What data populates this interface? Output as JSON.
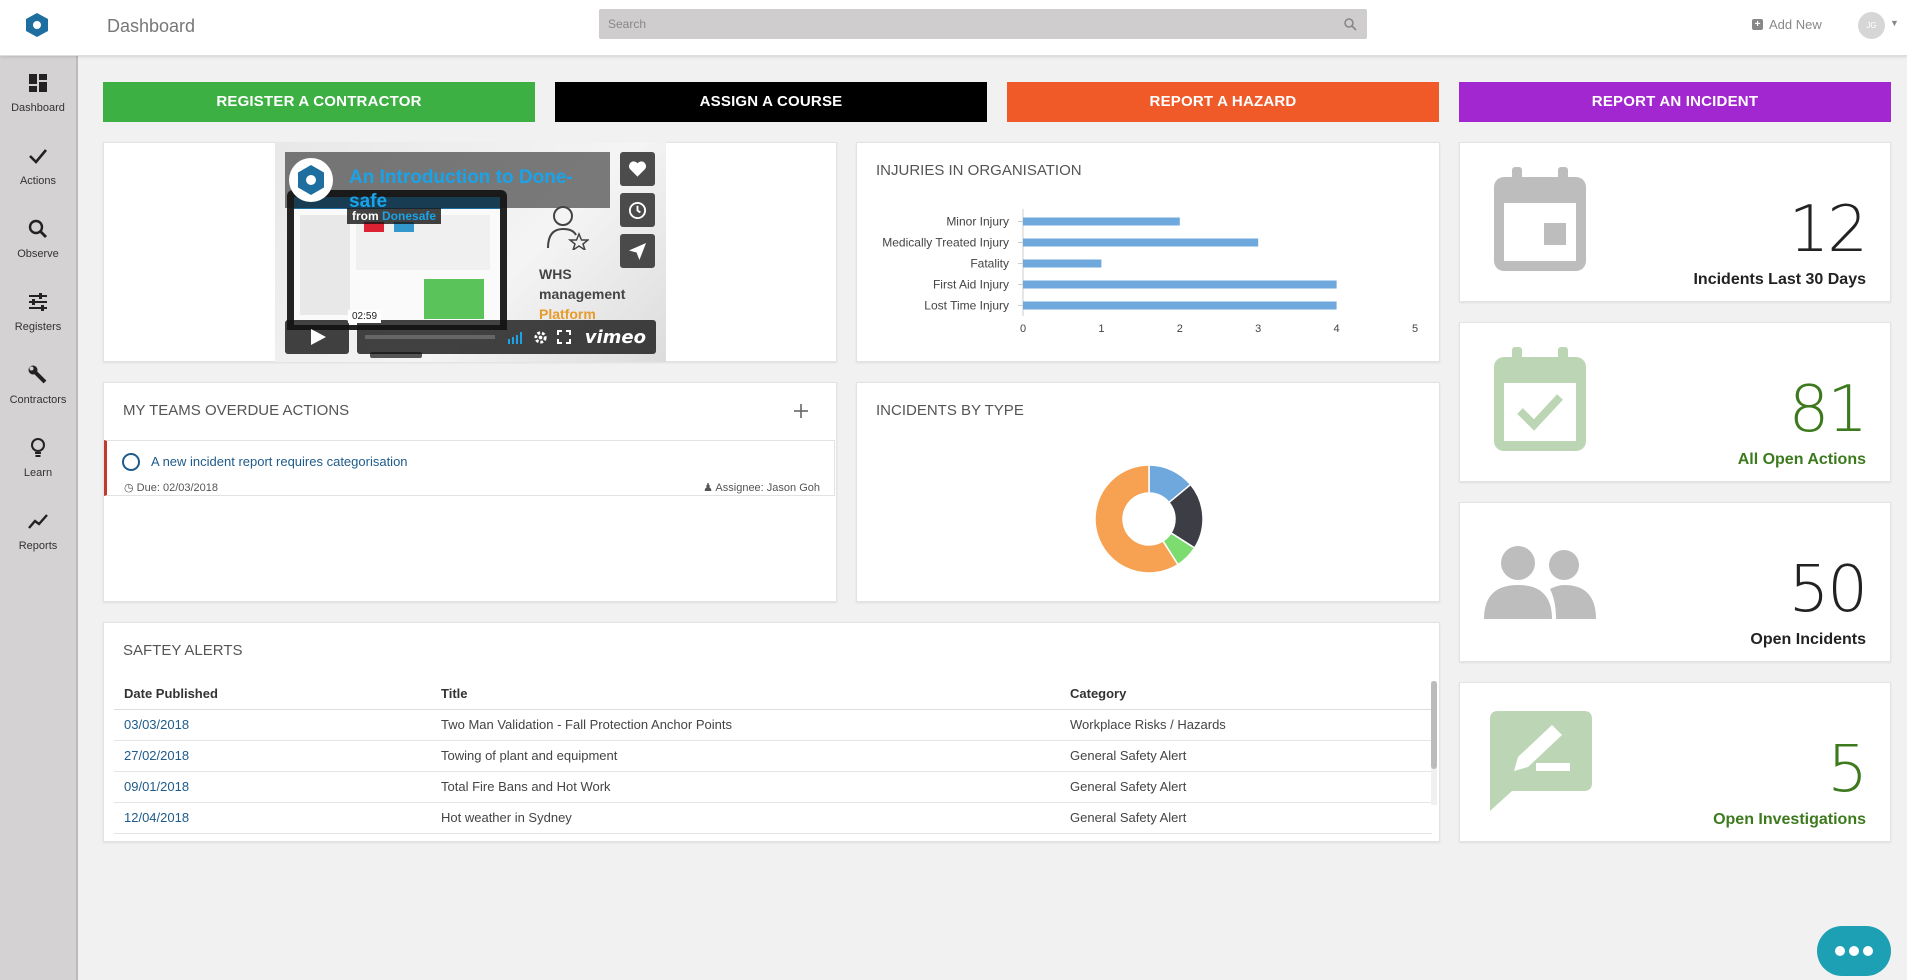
{
  "header": {
    "title": "Dashboard",
    "search_placeholder": "Search",
    "add_new_label": "Add New",
    "avatar_initials": "JG"
  },
  "sidebar": {
    "items": [
      {
        "label": "Dashboard",
        "icon": "dashboard-icon"
      },
      {
        "label": "Actions",
        "icon": "check-icon"
      },
      {
        "label": "Observe",
        "icon": "search-icon"
      },
      {
        "label": "Registers",
        "icon": "sliders-icon"
      },
      {
        "label": "Contractors",
        "icon": "wrench-icon"
      },
      {
        "label": "Learn",
        "icon": "lightbulb-icon"
      },
      {
        "label": "Reports",
        "icon": "trend-icon"
      }
    ]
  },
  "actions": [
    {
      "label": "REGISTER A CONTRACTOR",
      "color": "#3cb043"
    },
    {
      "label": "ASSIGN A COURSE",
      "color": "#000000"
    },
    {
      "label": "REPORT A HAZARD",
      "color": "#f05a28"
    },
    {
      "label": "REPORT AN INCIDENT",
      "color": "#a327d0"
    }
  ],
  "video": {
    "title": "An Introduction to Done-safe",
    "from_prefix": "from",
    "from_name": "Donesafe",
    "overlay_line1": "WHS",
    "overlay_line2": "management",
    "overlay_line3": "Platform",
    "duration": "02:59",
    "player_brand": "vimeo"
  },
  "injuries": {
    "title": "INJURIES IN ORGANISATION"
  },
  "chart_data": [
    {
      "type": "bar",
      "orientation": "horizontal",
      "title": "INJURIES IN ORGANISATION",
      "categories": [
        "Minor Injury",
        "Medically Treated Injury",
        "Fatality",
        "First Aid Injury",
        "Lost Time Injury"
      ],
      "values": [
        2,
        3,
        1,
        4,
        4
      ],
      "xlim": [
        0,
        5
      ],
      "xticks": [
        "0",
        "1",
        "2",
        "3",
        "4",
        "5"
      ],
      "color": "#6fa8dc"
    },
    {
      "type": "pie",
      "donut": true,
      "title": "INCIDENTS BY TYPE",
      "values": [
        14,
        20,
        7,
        59
      ],
      "colors": [
        "#6fa8dc",
        "#3d3d45",
        "#7ddc6f",
        "#f7a152"
      ]
    }
  ],
  "incidents_by_type": {
    "title": "INCIDENTS BY TYPE"
  },
  "overdue": {
    "title": "MY TEAMS OVERDUE ACTIONS",
    "items": [
      {
        "text": "A new incident report requires categorisation",
        "due": "Due: 02/03/2018",
        "assignee": "Assignee: Jason Goh"
      }
    ]
  },
  "stats": [
    {
      "value": "12",
      "label": "Incidents Last 30 Days",
      "color": "#222222",
      "icon": "calendar-icon"
    },
    {
      "value": "81",
      "label": "All Open Actions",
      "color": "#3d7a1e",
      "icon": "calendar-check-icon"
    },
    {
      "value": "50",
      "label": "Open Incidents",
      "color": "#222222",
      "icon": "users-icon"
    },
    {
      "value": "5",
      "label": "Open Investigations",
      "color": "#3d7a1e",
      "icon": "edit-comment-icon"
    }
  ],
  "alerts": {
    "title": "SAFTEY ALERTS",
    "columns": [
      "Date Published",
      "Title",
      "Category"
    ],
    "rows": [
      [
        "03/03/2018",
        "Two Man Validation - Fall Protection Anchor Points",
        "Workplace Risks / Hazards"
      ],
      [
        "27/02/2018",
        "Towing of plant and equipment",
        "General Safety Alert"
      ],
      [
        "09/01/2018",
        "Total Fire Bans and Hot Work",
        "General Safety Alert"
      ],
      [
        "12/04/2018",
        "Hot weather in Sydney",
        "General Safety Alert"
      ]
    ]
  }
}
